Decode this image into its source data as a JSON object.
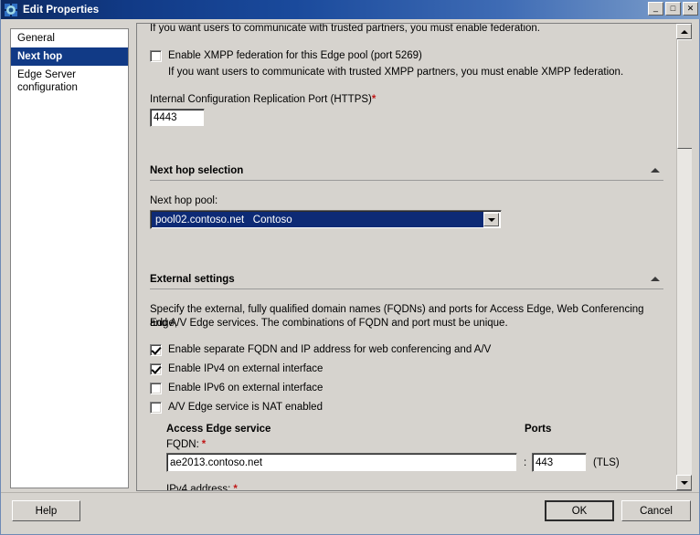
{
  "window": {
    "title": "Edit Properties",
    "icon": "server-gear-icon",
    "buttons": {
      "minimize": "_",
      "maximize": "□",
      "close": "✕"
    },
    "colors": {
      "title_gradient_start": "#0d2a62",
      "title_gradient_end": "#7fa0cb",
      "dialog_background": "#d6d3ce",
      "selection_blue": "#113a86",
      "combo_selection_blue": "#0d2a75",
      "required_asterisk": "#c01818"
    }
  },
  "sidebar": {
    "items": [
      {
        "label": "General",
        "selected": false
      },
      {
        "label": "Next hop",
        "selected": true
      },
      {
        "label": "Edge Server\nconfiguration",
        "selected": false
      }
    ]
  },
  "content": {
    "truncated_top_text": "If you want users to communicate with trusted partners, you must enable federation.",
    "xmpp_checkbox": {
      "label": "Enable XMPP federation for this Edge pool (port 5269)",
      "checked": false,
      "help_text": "If you want users to communicate with trusted XMPP partners, you must enable XMPP federation."
    },
    "replication_port": {
      "label": "Internal Configuration Replication Port (HTTPS)",
      "required_marker": "*",
      "value": "4443"
    },
    "next_hop_selection": {
      "header": "Next hop selection",
      "collapse_icon": "chevron-up-icon",
      "pool_label": "Next hop pool:",
      "pool_value": "pool02.contoso.net   Contoso",
      "dropdown_icon": "chevron-down-icon"
    },
    "external_settings": {
      "header": "External settings",
      "collapse_icon": "chevron-up-icon",
      "description_line1": "Specify the external, fully qualified domain names (FQDNs) and ports for Access Edge, Web Conferencing Edge,",
      "description_line2": "and A/V Edge services. The combinations of FQDN and port must be unique.",
      "checkboxes": [
        {
          "label": "Enable separate FQDN and IP address for web conferencing and A/V",
          "checked": true
        },
        {
          "label": "Enable IPv4 on external interface",
          "checked": true
        },
        {
          "label": "Enable IPv6 on external interface",
          "checked": false
        },
        {
          "label": "A/V Edge service is NAT enabled",
          "checked": false
        }
      ],
      "access_edge": {
        "title": "Access Edge service",
        "ports_column_header": "Ports",
        "fqdn_label": "FQDN:",
        "fqdn_required": "*",
        "fqdn_value": "ae2013.contoso.net",
        "port_separator": ":",
        "port_value": "443",
        "port_protocol": "(TLS)",
        "ipv4_label": "IPv4 address:",
        "ipv4_required": "*"
      }
    },
    "scrollbar": {
      "up_icon": "scroll-up-arrow-icon",
      "down_icon": "scroll-down-arrow-icon"
    }
  },
  "footer": {
    "help_label": "Help",
    "ok_label": "OK",
    "cancel_label": "Cancel"
  }
}
